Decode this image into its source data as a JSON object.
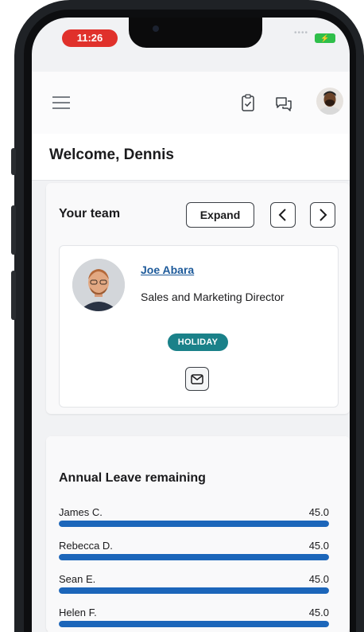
{
  "status_bar": {
    "time": "11:26",
    "battery_glyph": "⚡"
  },
  "app_bar": {
    "menu_icon": "hamburger-menu-icon",
    "tasks_icon": "clipboard-check-icon",
    "chat_icon": "chat-bubbles-icon",
    "profile_avatar": "user-avatar"
  },
  "welcome": {
    "text": "Welcome, Dennis"
  },
  "team": {
    "title": "Your team",
    "expand_label": "Expand",
    "member": {
      "name": "Joe Abara",
      "role": "Sales and Marketing Director",
      "status": "HOLIDAY"
    },
    "accent": "#1a8189"
  },
  "leave": {
    "title": "Annual Leave remaining",
    "rows": [
      {
        "name": "James C.",
        "value": "45.0",
        "fraction": 1.0
      },
      {
        "name": "Rebecca D.",
        "value": "45.0",
        "fraction": 1.0
      },
      {
        "name": "Sean E.",
        "value": "45.0",
        "fraction": 1.0
      },
      {
        "name": "Helen F.",
        "value": "45.0",
        "fraction": 1.0
      }
    ],
    "bar_color": "#1c66ba"
  },
  "colors": {
    "status_pill": "#e0312b",
    "link": "#1d5a9a",
    "badge": "#1a8189",
    "bar": "#1c66ba"
  }
}
